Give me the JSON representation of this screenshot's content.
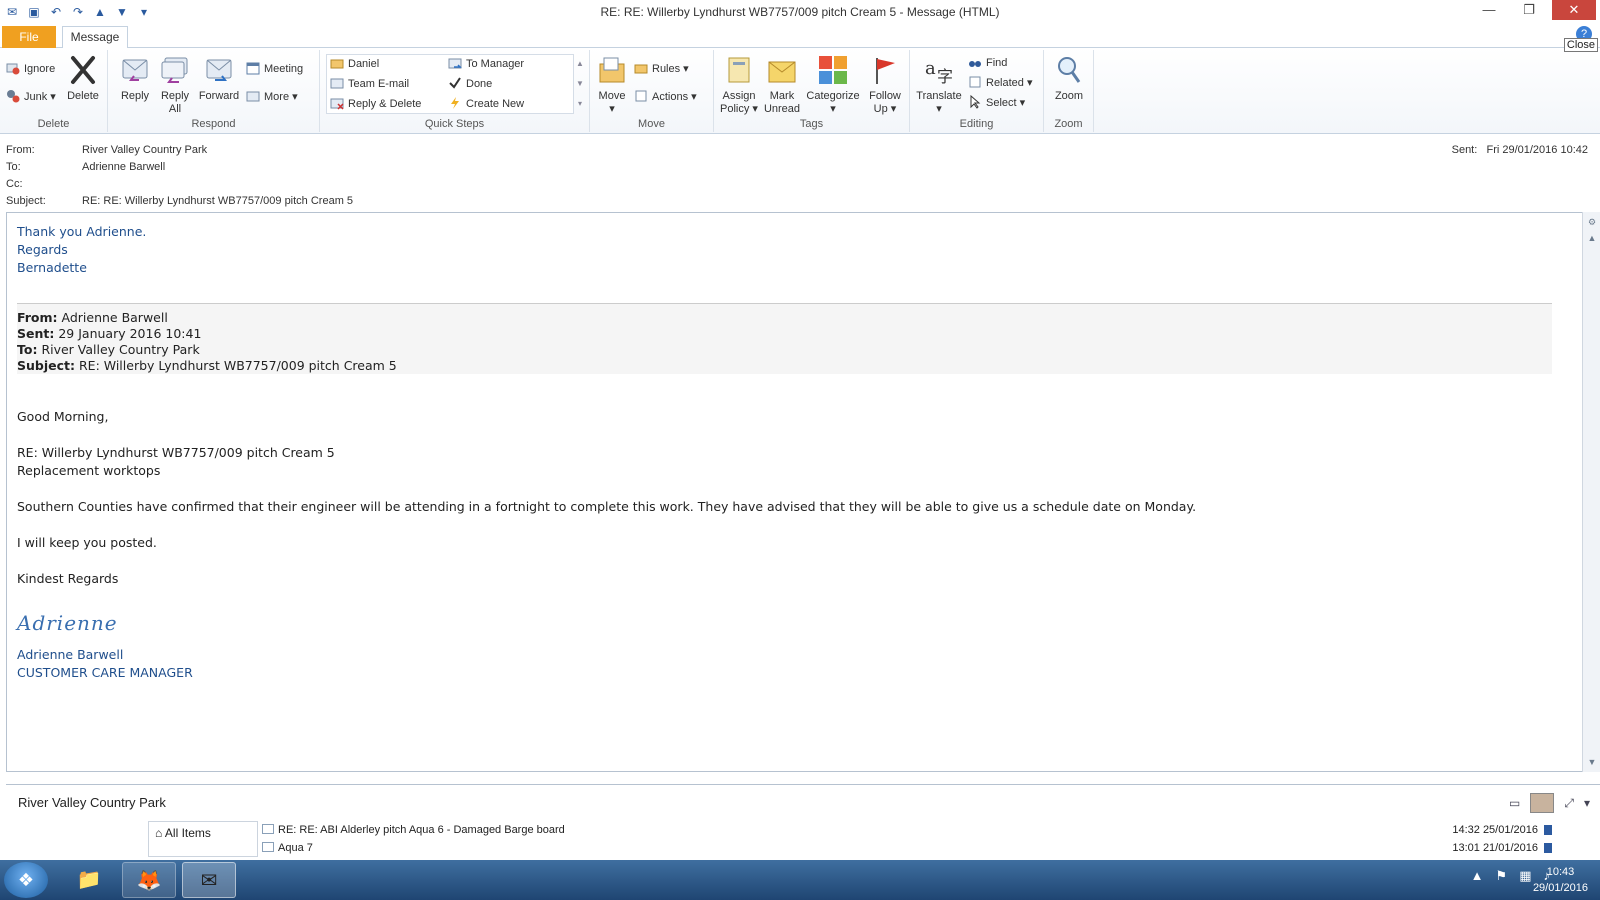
{
  "window": {
    "title": "RE: RE: Willerby Lyndhurst WB7757/009 pitch Cream 5  -  Message (HTML)",
    "close_tooltip": "Close"
  },
  "tabs": [
    {
      "label": "File"
    },
    {
      "label": "Message"
    }
  ],
  "ribbon": {
    "delete": {
      "label": "Delete",
      "ignore": "Ignore",
      "junk": "Junk",
      "delete_btn": "Delete"
    },
    "respond": {
      "label": "Respond",
      "reply": "Reply",
      "reply_all_1": "Reply",
      "reply_all_2": "All",
      "forward": "Forward",
      "meeting": "Meeting",
      "more": "More"
    },
    "quick_steps": {
      "label": "Quick Steps",
      "items": [
        "Daniel",
        "Team E-mail",
        "Reply & Delete",
        "To Manager",
        "Done",
        "Create New"
      ]
    },
    "move": {
      "label": "Move",
      "move_btn": "Move",
      "rules": "Rules",
      "actions": "Actions"
    },
    "tags": {
      "label": "Tags",
      "assign_1": "Assign",
      "assign_2": "Policy",
      "mark_1": "Mark",
      "mark_2": "Unread",
      "categorize": "Categorize",
      "follow_1": "Follow",
      "follow_2": "Up"
    },
    "editing": {
      "label": "Editing",
      "translate": "Translate",
      "find": "Find",
      "related": "Related",
      "select": "Select"
    },
    "zoom": {
      "label": "Zoom",
      "zoom_btn": "Zoom"
    }
  },
  "header": {
    "from_label": "From:",
    "from": "River Valley Country Park",
    "to_label": "To:",
    "to": "Adrienne Barwell",
    "cc_label": "Cc:",
    "cc": "",
    "subject_label": "Subject:",
    "subject": "RE: RE: Willerby Lyndhurst WB7757/009 pitch Cream 5",
    "sent_label": "Sent:",
    "sent": "Fri 29/01/2016 10:42"
  },
  "body": {
    "reply_lines": [
      "Thank you Adrienne.",
      "Regards",
      "Bernadette"
    ],
    "quoted": {
      "from_label": "From:",
      "from": "Adrienne Barwell",
      "sent_label": "Sent:",
      "sent": "29 January 2016 10:41",
      "to_label": "To:",
      "to": "River Valley Country Park",
      "subject_label": "Subject:",
      "subject": "RE: Willerby Lyndhurst WB7757/009 pitch Cream 5"
    },
    "greeting": "Good Morning,",
    "ref_line1": "RE: Willerby Lyndhurst WB7757/009 pitch Cream 5",
    "ref_line2": "Replacement worktops",
    "para1": "Southern Counties have confirmed that their  engineer will be attending in a fortnight to complete this work.  They have advised that they will be able to give us a schedule date on Monday.",
    "para2": "I will keep you posted.",
    "closing": "Kindest Regards",
    "signature_script": "Adrienne",
    "sig_name": "Adrienne Barwell",
    "sig_title": "CUSTOMER CARE MANAGER"
  },
  "people_pane": {
    "name": "River Valley Country Park",
    "all_items": "All Items",
    "messages": [
      {
        "subject": "RE: RE: ABI Alderley pitch Aqua 6 - Damaged Barge board",
        "date": "14:32  25/01/2016"
      },
      {
        "subject": "Aqua 7",
        "date": "13:01  21/01/2016"
      }
    ]
  },
  "taskbar": {
    "time": "10:43",
    "date": "29/01/2016"
  }
}
